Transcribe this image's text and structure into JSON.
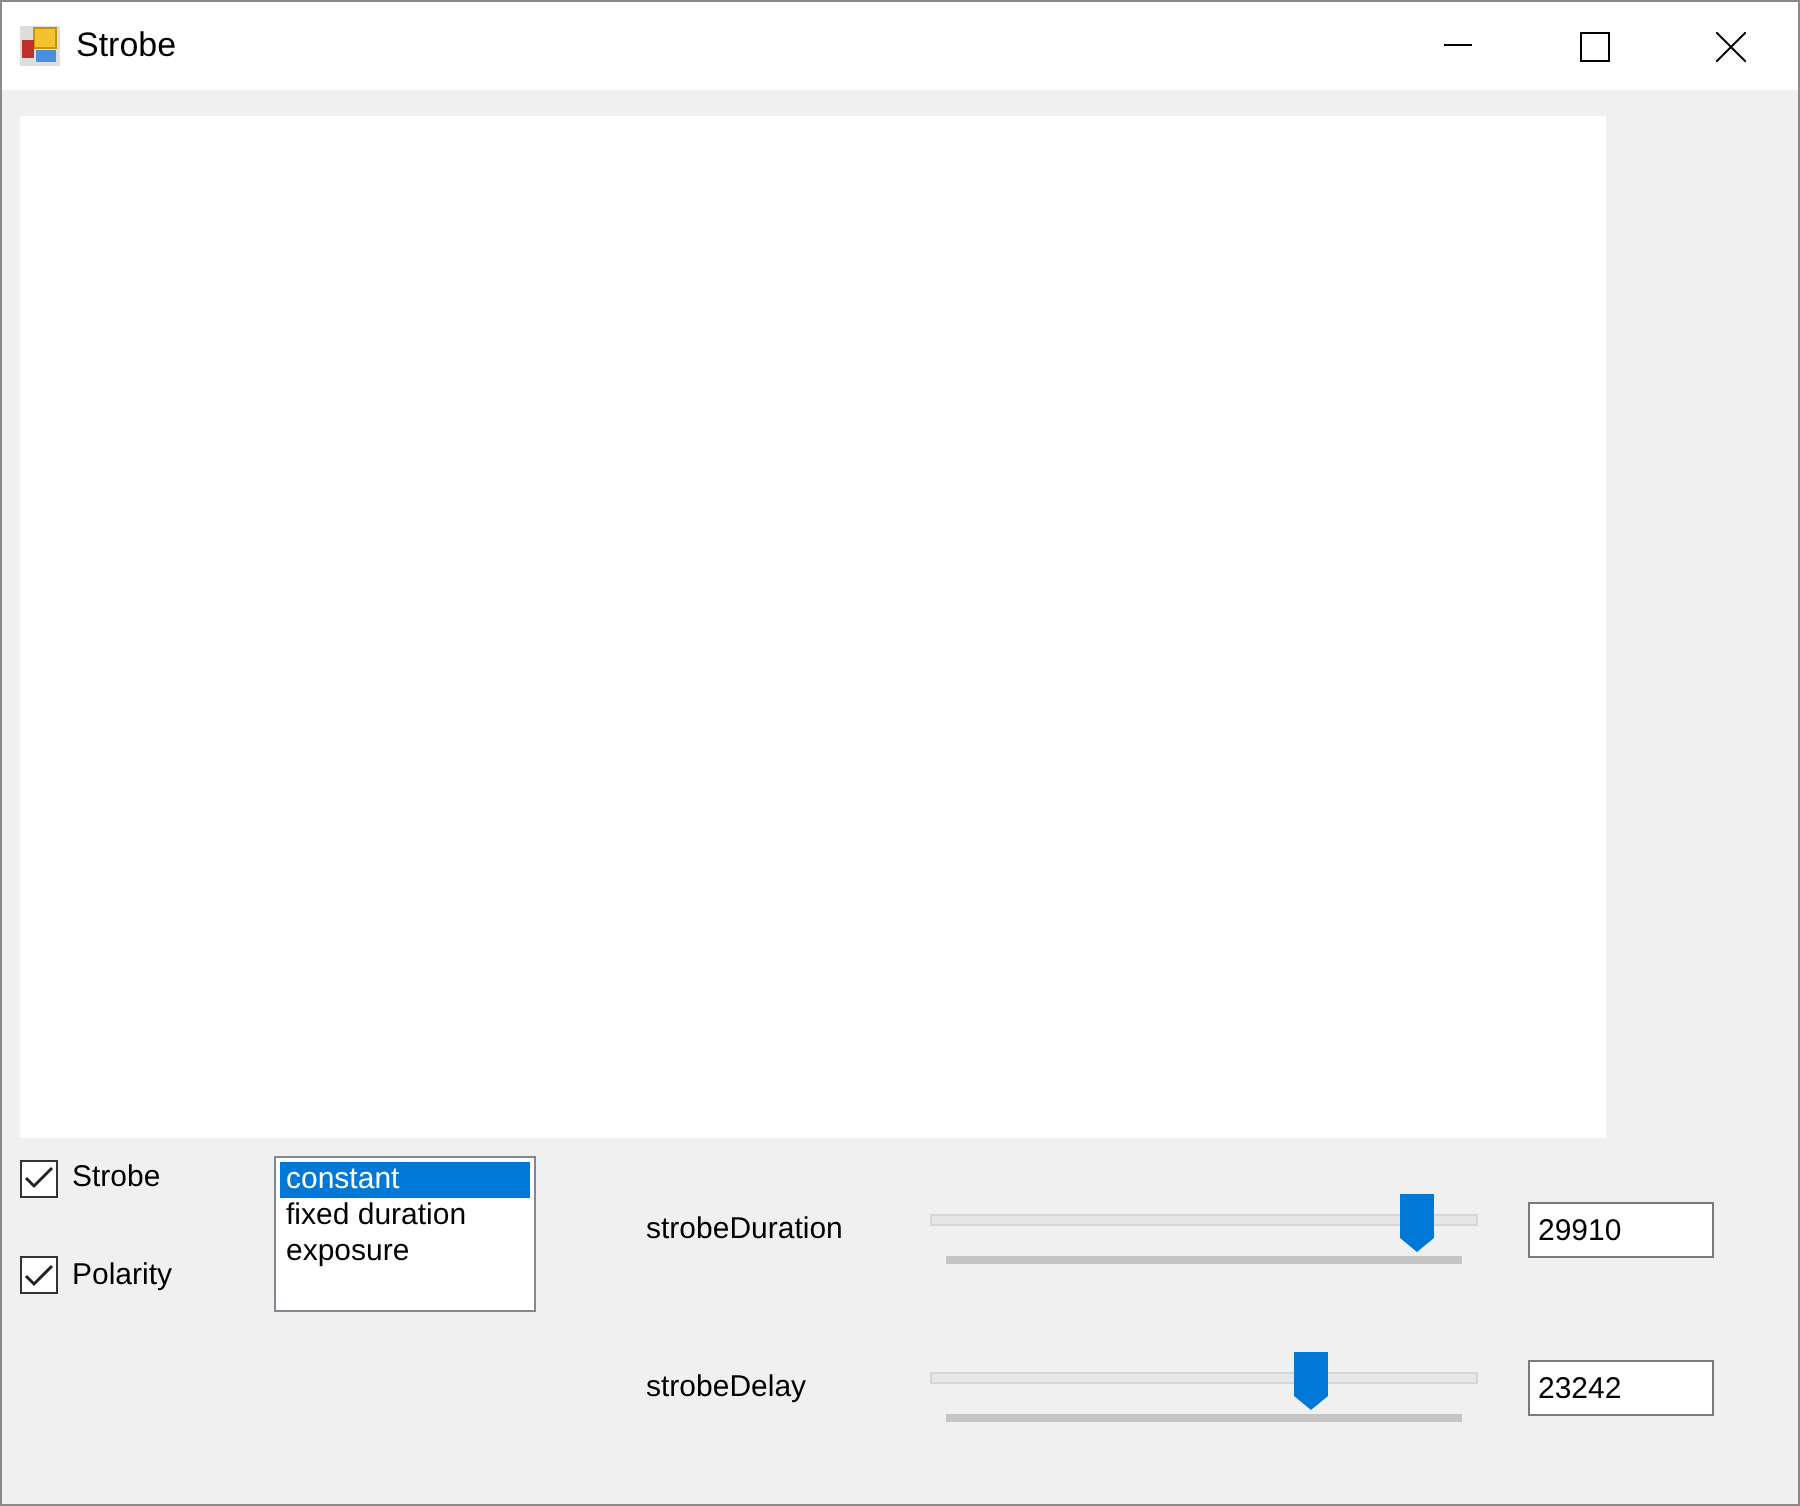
{
  "window": {
    "title": "Strobe"
  },
  "checkboxes": [
    {
      "label": "Strobe",
      "checked": true
    },
    {
      "label": "Polarity",
      "checked": true
    }
  ],
  "mode_list": [
    {
      "label": "constant",
      "selected": true
    },
    {
      "label": "fixed duration",
      "selected": false
    },
    {
      "label": "exposure",
      "selected": false
    }
  ],
  "sliders": [
    {
      "label": "strobeDuration",
      "level": 0.913,
      "value": "29910"
    },
    {
      "label": "strobeDelay",
      "level": 0.709,
      "value": "23242"
    }
  ]
}
